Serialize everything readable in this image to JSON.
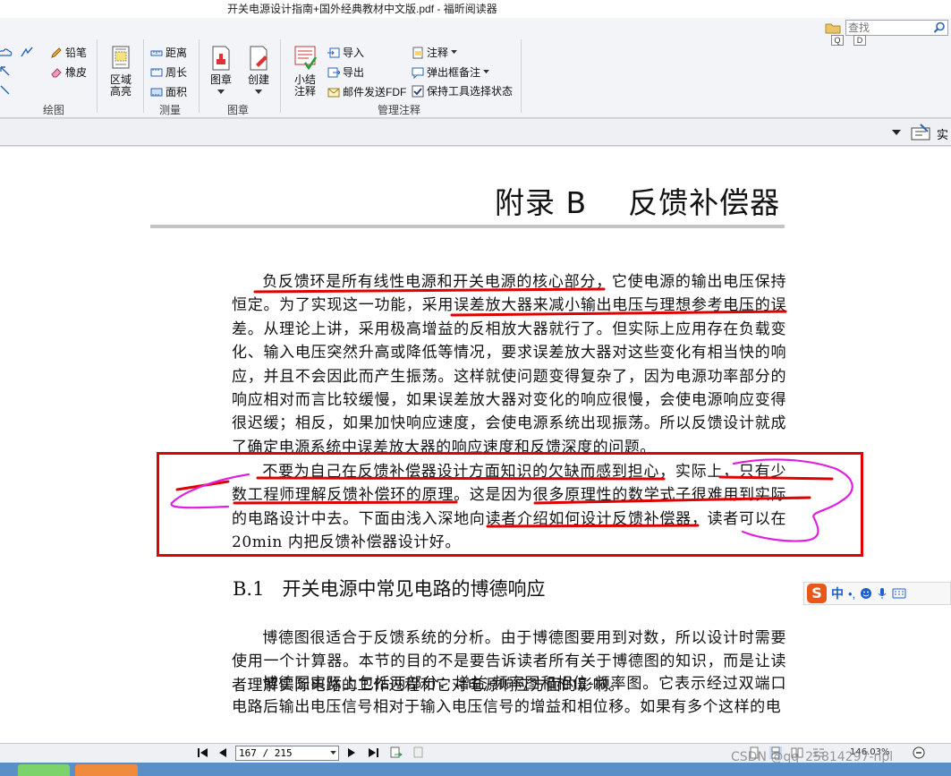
{
  "window": {
    "title": "开关电源设计指南+国外经典教材中文版.pdf - 福昕阅读器"
  },
  "search": {
    "placeholder": "查找",
    "q_label": "Q",
    "d_label": "D"
  },
  "ribbon": {
    "draw": {
      "pencil": "铅笔",
      "eraser": "橡皮",
      "group": "绘图"
    },
    "highlight": {
      "area": "区域",
      "highlight": "高亮"
    },
    "measure": {
      "distance": "距离",
      "perimeter": "周长",
      "area": "面积",
      "group": "测量"
    },
    "stamp": {
      "stamp": "图章",
      "create": "创建",
      "group": "图章"
    },
    "manage": {
      "summary_1": "小结",
      "summary_2": "注释",
      "import": "导入",
      "export": "导出",
      "email_pdf": "邮件发送FDF",
      "annotation": "注释",
      "popup_note": "弹出框备注",
      "keep_tool": "保持工具选择状态",
      "group": "管理注释"
    }
  },
  "toolbar_right": {
    "label": "实"
  },
  "document": {
    "heading": "附录 B    反馈补偿器",
    "para1": "负反馈环是所有线性电源和开关电源的核心部分，它使电源的输出电压保持恒定。为了实现这一功能，采用误差放大器来减小输出电压与理想参考电压的误差。从理论上讲，采用极高增益的反相放大器就行了。但实际上应用存在负载变化、输入电压突然升高或降低等情况，要求误差放大器对这些变化有相当快的响应，并且不会因此而产生振荡。这样就使问题变得复杂了，因为电源功率部分的响应相对而言比较缓慢，如果误差放大器对变化的响应很慢，会使电源响应变得很迟缓；相反，如果加快响应速度，会使电源系统出现振荡。所以反馈设计就成了确定电源系统中误差放大器的响应速度和反馈深度的问题。",
    "para2": "不要为自己在反馈补偿器设计方面知识的欠缺而感到担心，实际上，只有少数工程师理解反馈补偿环的原理。这是因为很多原理性的数学式子很难用到实际的电路设计中去。下面由浅入深地向读者介绍如何设计反馈补偿器，读者可以在20min 内把反馈补偿器设计好。",
    "section_num": "B.1",
    "section_title": "开关电源中常见电路的博德响应",
    "para3": "博德图很适合于反馈系统的分析。由于博德图要用到对数，所以设计时需要使用一个计算器。本节的目的不是要告诉读者所有关于博德图的知识，而是让读者理解实际电路的工作过程和它对电源响应方面的影响。",
    "para4": "博德图实际上包括两部分：增益-频率图和相位-频率图。它表示经过双端口电路后输出电压信号相对于输入电压信号的增益和相位移。如果有多个这样的电"
  },
  "ime": {
    "mode": "中",
    "punct": "•,"
  },
  "status": {
    "page": "167 / 215",
    "zoom": "146.03%"
  },
  "watermark": "CSDN @qq_25814297-npl",
  "colors": {
    "annotation_red": "#e00000",
    "annotation_magenta": "#e020e0",
    "accent_blue": "#1a5fd0"
  }
}
